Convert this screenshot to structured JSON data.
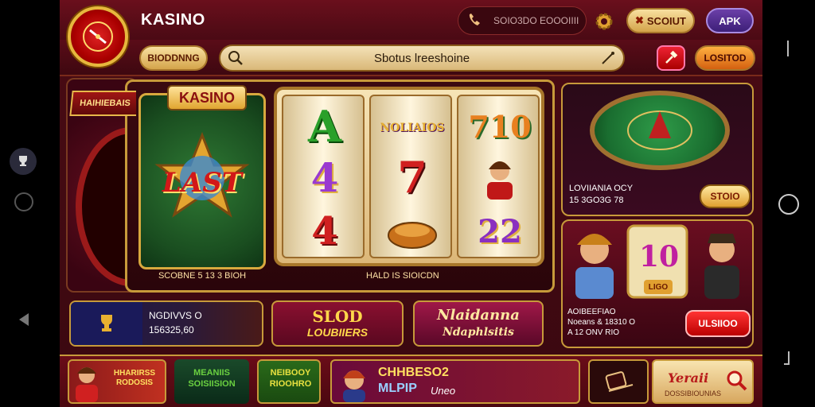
{
  "header": {
    "title": "KASINO",
    "phone_text": "SOIO3DO EOOOIIII",
    "login_label": "SCOIUT",
    "apk_label": "APK"
  },
  "toolbar": {
    "bonus_label": "BIODDNNG",
    "search_text": "Sbotus lreeshoine",
    "lost_label": "LOSITOD"
  },
  "roulette_side": {
    "badge": "HAIHIEBAIS"
  },
  "slot_panel": {
    "card_badge": "KASINO",
    "card_logo": "LAST",
    "card_caption": "SCOBNE 5 13 3 BIOH",
    "reels_caption": "HALD IS SIOICDN",
    "reel1": [
      "A",
      "4",
      "4"
    ],
    "reel2": [
      "NOLIAIOS",
      "7",
      ""
    ],
    "reel3": [
      "710",
      "",
      "22"
    ]
  },
  "roulette_table": {
    "label_line1": "LOVIIANIA OCY",
    "label_line2": "15 3GO3G 78",
    "button": "STOIO"
  },
  "promo_right": {
    "big_number": "10",
    "sub_number": "LIGO",
    "label_line1": "AOIBEEFIAO",
    "label_line2": "Noeans & 18310 O",
    "label_line3": "A 12 ONV RIO",
    "button": "ULSIIOO"
  },
  "tiles": {
    "t1_line1": "NGDIVVS O",
    "t1_line2": "156325,60",
    "t2_line1": "SLOD",
    "t2_line2": "LOUBIIERS",
    "t3_line1": "Nlaidanna",
    "t3_line2": "Ndaphlsitis"
  },
  "bottom": {
    "b1_text": "HHARIRSS RODOSIS",
    "b2_text": "MEANIIS SOISIISION",
    "b3_text": "NEIBOOY RIOOHRO",
    "b4_line1": "CHHBESO2",
    "b4_line2": "MLPIP",
    "b4_line3": "Uneo",
    "b5_text": "Yeraii",
    "b5_sub": "DOSSIBIOUNIAS"
  },
  "colors": {
    "accent_gold": "#c79a3a",
    "brand_red": "#a00000",
    "bg_maroon": "#4a0b14"
  }
}
